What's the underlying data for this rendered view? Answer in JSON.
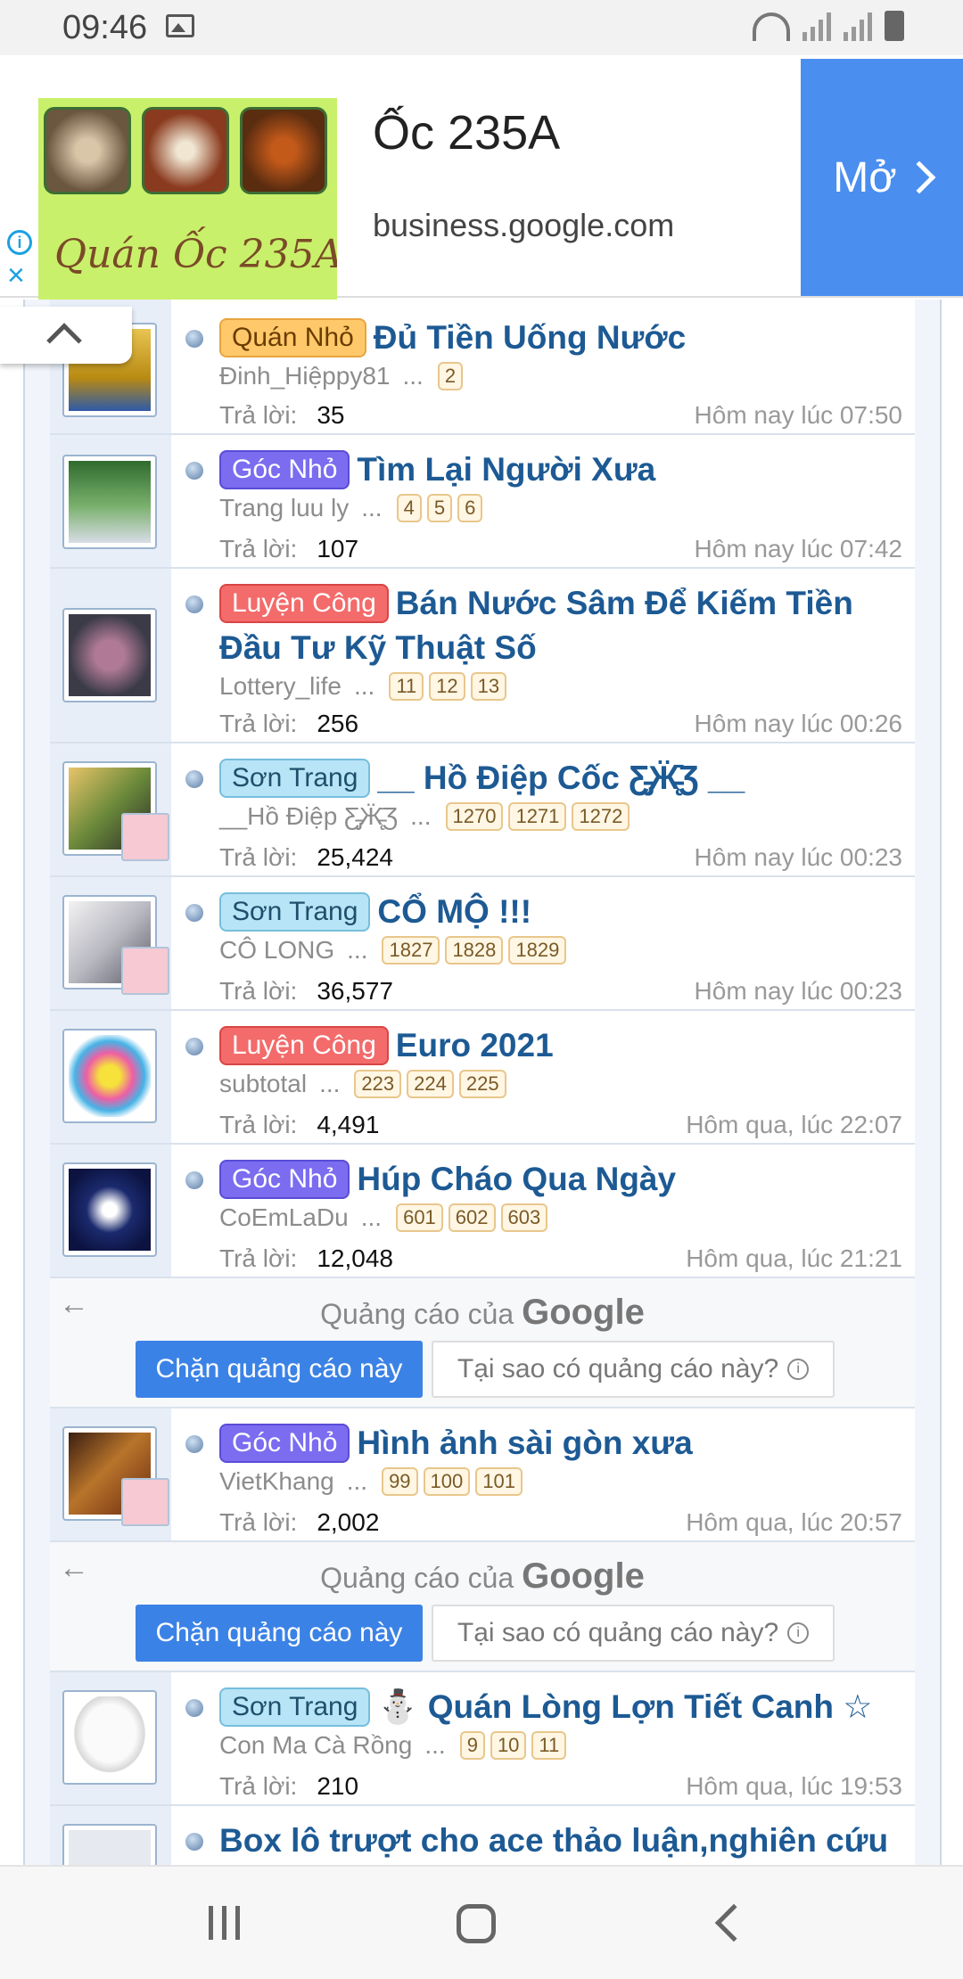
{
  "status_bar": {
    "time": "09:46"
  },
  "ad": {
    "title": "Ốc 235A",
    "url": "business.google.com",
    "image_caption": "Quán Ốc 235A",
    "open_label": "Mở"
  },
  "google_ad_notice": {
    "label_prefix": "Quảng cáo của",
    "label_brand": "Google",
    "block_label": "Chặn quảng cáo này",
    "why_label": "Tại sao có quảng cáo này?"
  },
  "reply_label": "Trả lời:",
  "threads": [
    {
      "prefix": "Quán Nhỏ",
      "title": "Đủ Tiền Uống Nước",
      "author": "Đinh_Hiệppy81",
      "pages": [
        "2"
      ],
      "replies": "35",
      "date": "Hôm nay lúc 07:50"
    },
    {
      "prefix": "Góc Nhỏ",
      "title": "Tìm Lại Người Xưa",
      "author": "Trang luu ly",
      "pages": [
        "4",
        "5",
        "6"
      ],
      "replies": "107",
      "date": "Hôm nay lúc 07:42"
    },
    {
      "prefix": "Luyện Công",
      "title": "Bán Nước Sâm Để Kiếm Tiền Đầu Tư Kỹ Thuật Số",
      "author": "Lottery_life",
      "pages": [
        "11",
        "12",
        "13"
      ],
      "replies": "256",
      "date": "Hôm nay lúc 00:26"
    },
    {
      "prefix": "Sơn Trang",
      "title": "__ Hồ Điệp Cốc Ƹ̵̡Ӝ̵̨̄Ʒ __",
      "author": "__Hồ Điệp Ƹ̵̡Ӝ̵̨̄Ʒ",
      "pages": [
        "1270",
        "1271",
        "1272"
      ],
      "replies": "25,424",
      "date": "Hôm nay lúc 00:23"
    },
    {
      "prefix": "Sơn Trang",
      "title": "CỔ MỘ !!!",
      "author": "CÔ LONG",
      "pages": [
        "1827",
        "1828",
        "1829"
      ],
      "replies": "36,577",
      "date": "Hôm nay lúc 00:23"
    },
    {
      "prefix": "Luyện Công",
      "title": "Euro 2021",
      "author": "subtotal",
      "pages": [
        "223",
        "224",
        "225"
      ],
      "replies": "4,491",
      "date": "Hôm qua, lúc 22:07"
    },
    {
      "prefix": "Góc Nhỏ",
      "title": "Húp Cháo Qua Ngày",
      "author": "CoEmLaDu",
      "pages": [
        "601",
        "602",
        "603"
      ],
      "replies": "12,048",
      "date": "Hôm qua, lúc 21:21"
    },
    {
      "prefix": "Góc Nhỏ",
      "title": "Hình ảnh sài gòn xưa",
      "author": "VietKhang",
      "pages": [
        "99",
        "100",
        "101"
      ],
      "replies": "2,002",
      "date": "Hôm qua, lúc 20:57"
    },
    {
      "prefix": "Sơn Trang",
      "title_emoji": "⛄",
      "title": "Quán Lòng Lợn Tiết Canh ☆",
      "author": "Con Ma Cà Rồng",
      "pages": [
        "9",
        "10",
        "11"
      ],
      "replies": "210",
      "date": "Hôm qua, lúc 19:53"
    },
    {
      "title": "Box lô trượt cho ace thảo luận,nghiên cứu"
    }
  ]
}
